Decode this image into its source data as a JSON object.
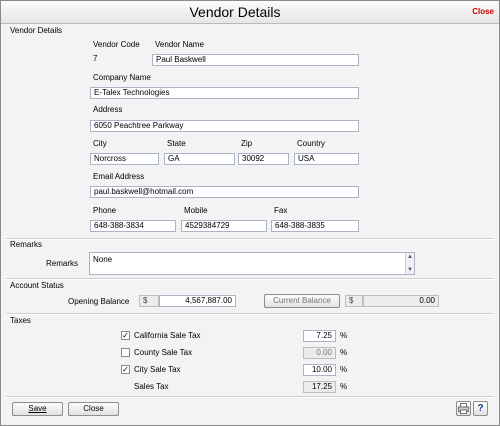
{
  "window": {
    "title": "Vendor Details",
    "close_label": "Close"
  },
  "vendor_details": {
    "section_label": "Vendor Details",
    "vendor_code_label": "Vendor Code",
    "vendor_code": "7",
    "vendor_name_label": "Vendor Name",
    "vendor_name": "Paul Baskwell",
    "company_name_label": "Company Name",
    "company_name": "E-Talex Technologies",
    "address_label": "Address",
    "address": "6050 Peachtree Parkway",
    "city_label": "City",
    "city": "Norcross",
    "state_label": "State",
    "state": "GA",
    "zip_label": "Zip",
    "zip": "30092",
    "country_label": "Country",
    "country": "USA",
    "email_label": "Email Address",
    "email": "paul.baskwell@hotmail.com",
    "phone_label": "Phone",
    "phone": "648-388-3834",
    "mobile_label": "Mobile",
    "mobile": "4529384729",
    "fax_label": "Fax",
    "fax": "648-388-3835"
  },
  "remarks": {
    "section_label": "Remarks",
    "field_label": "Remarks",
    "value": "None"
  },
  "account_status": {
    "section_label": "Account Status",
    "opening_balance_label": "Opening Balance",
    "currency_symbol": "$",
    "opening_balance": "4,567,887.00",
    "current_balance_button": "Current Balance",
    "current_balance_currency": "$",
    "current_balance": "0.00"
  },
  "taxes": {
    "section_label": "Taxes",
    "percent_symbol": "%",
    "items": [
      {
        "label": "California Sale Tax",
        "checked": true,
        "value": "7.25"
      },
      {
        "label": "County Sale Tax",
        "checked": false,
        "value": "0.00"
      },
      {
        "label": "City Sale Tax",
        "checked": true,
        "value": "10.00"
      }
    ],
    "total_label": "Sales Tax",
    "total_value": "17.25"
  },
  "footer": {
    "save_label": "Save",
    "close_label": "Close",
    "print_icon": "printer-icon",
    "help_icon": "help-icon"
  },
  "colors": {
    "close_link": "#d20000",
    "field_border": "#a9b4c4"
  }
}
